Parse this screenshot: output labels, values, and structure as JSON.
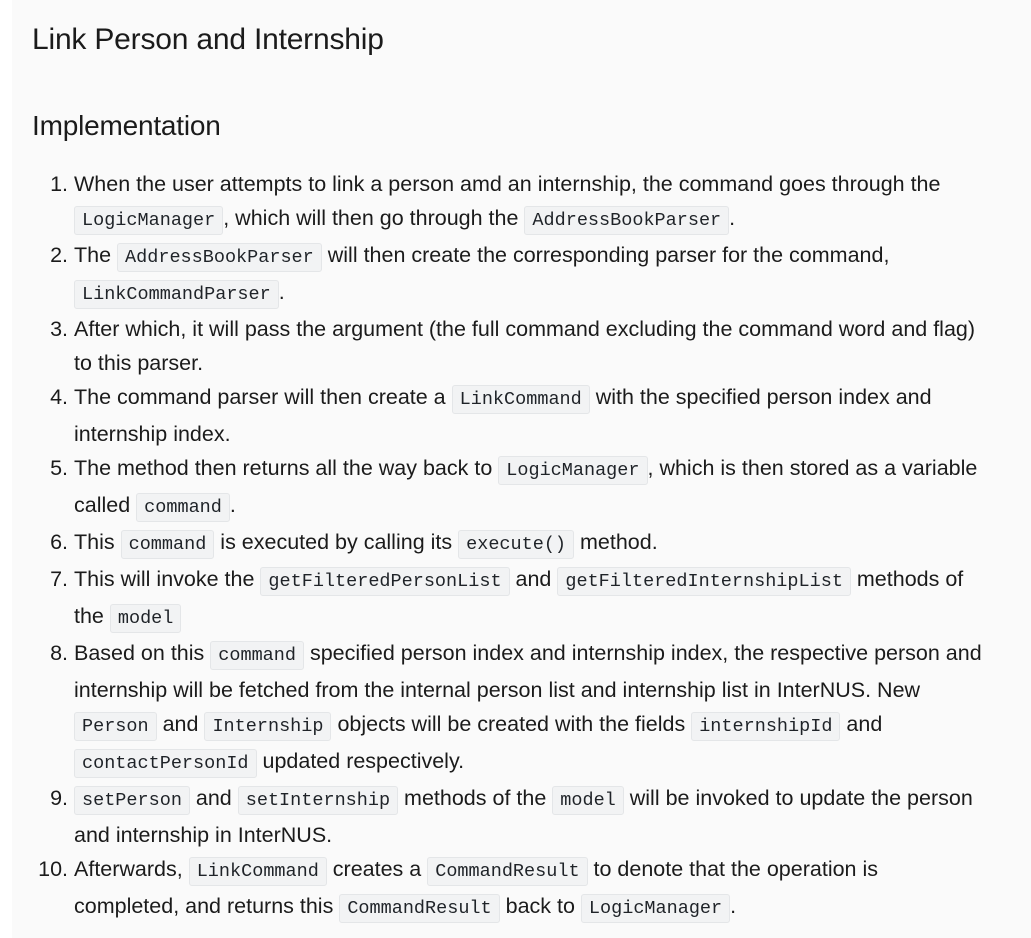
{
  "page": {
    "title": "Link Person and Internship",
    "section": "Implementation"
  },
  "steps": [
    {
      "segments": [
        {
          "text": "When the user attempts to link a person amd an internship, the command goes through the "
        },
        {
          "code": "LogicManager"
        },
        {
          "text": ", which will then go through the "
        },
        {
          "code": "AddressBookParser"
        },
        {
          "text": "."
        }
      ]
    },
    {
      "segments": [
        {
          "text": "The "
        },
        {
          "code": "AddressBookParser"
        },
        {
          "text": " will then create the corresponding parser for the command, "
        },
        {
          "code": "LinkCommandParser"
        },
        {
          "text": "."
        }
      ]
    },
    {
      "segments": [
        {
          "text": "After which, it will pass the argument (the full command excluding the command word and flag) to this parser."
        }
      ]
    },
    {
      "segments": [
        {
          "text": "The command parser will then create a "
        },
        {
          "code": "LinkCommand"
        },
        {
          "text": " with the specified person index and internship index."
        }
      ]
    },
    {
      "segments": [
        {
          "text": "The method then returns all the way back to "
        },
        {
          "code": "LogicManager"
        },
        {
          "text": ", which is then stored as a variable called "
        },
        {
          "code": "command"
        },
        {
          "text": "."
        }
      ]
    },
    {
      "segments": [
        {
          "text": "This "
        },
        {
          "code": "command"
        },
        {
          "text": " is executed by calling its "
        },
        {
          "code": "execute()"
        },
        {
          "text": " method."
        }
      ]
    },
    {
      "segments": [
        {
          "text": "This will invoke the "
        },
        {
          "code": "getFilteredPersonList"
        },
        {
          "text": " and "
        },
        {
          "code": "getFilteredInternshipList"
        },
        {
          "text": " methods of the "
        },
        {
          "code": "model"
        }
      ]
    },
    {
      "segments": [
        {
          "text": "Based on this "
        },
        {
          "code": "command"
        },
        {
          "text": " specified person index and internship index, the respective person and internship will be fetched from the internal person list and internship list in InterNUS. New "
        },
        {
          "code": "Person"
        },
        {
          "text": " and "
        },
        {
          "code": "Internship"
        },
        {
          "text": " objects will be created with the fields "
        },
        {
          "code": "internshipId"
        },
        {
          "text": " and "
        },
        {
          "code": "contactPersonId"
        },
        {
          "text": " updated respectively."
        }
      ]
    },
    {
      "segments": [
        {
          "code": "setPerson"
        },
        {
          "text": " and "
        },
        {
          "code": "setInternship"
        },
        {
          "text": " methods of the "
        },
        {
          "code": "model"
        },
        {
          "text": " will be invoked to update the person and internship in InterNUS."
        }
      ]
    },
    {
      "segments": [
        {
          "text": "Afterwards, "
        },
        {
          "code": "LinkCommand"
        },
        {
          "text": " creates a "
        },
        {
          "code": "CommandResult"
        },
        {
          "text": " to denote that the operation is completed, and returns this "
        },
        {
          "code": "CommandResult"
        },
        {
          "text": " back to "
        },
        {
          "code": "LogicManager"
        },
        {
          "text": "."
        }
      ]
    }
  ]
}
